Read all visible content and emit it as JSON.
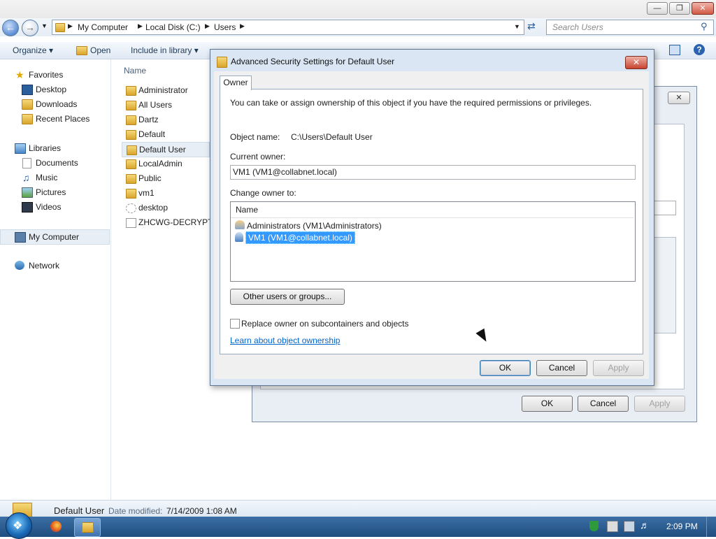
{
  "explorer": {
    "address": [
      "My Computer",
      "Local Disk (C:)",
      "Users"
    ],
    "search_placeholder": "Search Users",
    "toolbar": {
      "organize": "Organize",
      "open": "Open",
      "include": "Include in library"
    },
    "column_name": "Name",
    "nav": {
      "favorites": "Favorites",
      "desktop": "Desktop",
      "downloads": "Downloads",
      "recent": "Recent Places",
      "libraries": "Libraries",
      "documents": "Documents",
      "music": "Music",
      "pictures": "Pictures",
      "videos": "Videos",
      "mycomputer": "My Computer",
      "network": "Network"
    },
    "files": [
      "Administrator",
      "All Users",
      "Dartz",
      "Default",
      "Default User",
      "LocalAdmin",
      "Public",
      "vm1",
      "desktop",
      "ZHCWG-DECRYPT"
    ],
    "status": {
      "name": "Default User",
      "modified_label": "Date modified:",
      "modified_value": "7/14/2009 1:08 AM"
    }
  },
  "taskbar": {
    "clock": "2:09 PM"
  },
  "back_dialog": {
    "ok": "OK",
    "cancel": "Cancel",
    "apply": "Apply"
  },
  "dialog": {
    "title": "Advanced Security Settings for Default User",
    "tab": "Owner",
    "intro": "You can take or assign ownership of this object if you have the required permissions or privileges.",
    "object_name_label": "Object name:",
    "object_name_value": "C:\\Users\\Default User",
    "current_owner_label": "Current owner:",
    "current_owner_value": "VM1 (VM1@collabnet.local)",
    "change_owner_label": "Change owner to:",
    "list_header": "Name",
    "list": [
      "Administrators (VM1\\Administrators)",
      "VM1 (VM1@collabnet.local)"
    ],
    "other_users": "Other users or groups...",
    "replace_label": "Replace owner on subcontainers and objects",
    "learn_link": "Learn about object ownership",
    "ok": "OK",
    "cancel": "Cancel",
    "apply": "Apply"
  }
}
